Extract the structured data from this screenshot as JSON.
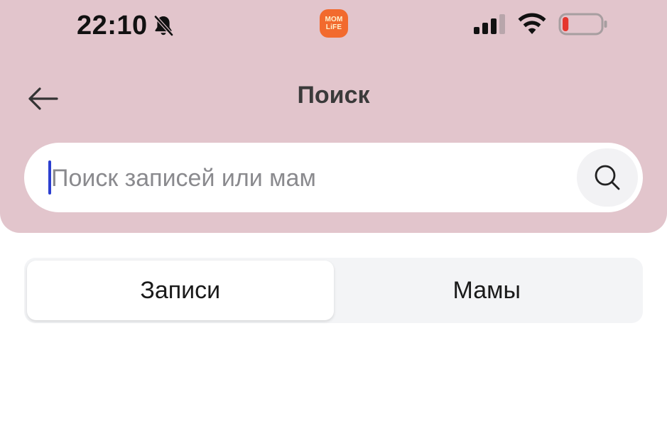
{
  "theme": {
    "header_bg": "#e2c5cc",
    "accent_caret": "#2c3fd0",
    "segment_track_bg": "#f3f4f6",
    "search_button_bg": "#f2f2f4",
    "app_badge_bg": "#f26a2e",
    "app_badge_text": "#fff3cf",
    "battery_level_color": "#e5362e"
  },
  "status_bar": {
    "time": "22:10",
    "mute_icon": "bell-slash-icon",
    "app_badge": {
      "line1": "MOM",
      "line2": "LiFE"
    },
    "signal_icon": "cellular-signal-icon",
    "wifi_icon": "wifi-icon",
    "battery_icon": "battery-icon",
    "battery_level": 0.12
  },
  "nav": {
    "back_icon": "arrow-left-icon",
    "title": "Поиск"
  },
  "search": {
    "value": "",
    "placeholder": "Поиск записей или мам",
    "button_icon": "search-icon"
  },
  "tabs": [
    {
      "label": "Записи",
      "active": true
    },
    {
      "label": "Мамы",
      "active": false
    }
  ]
}
